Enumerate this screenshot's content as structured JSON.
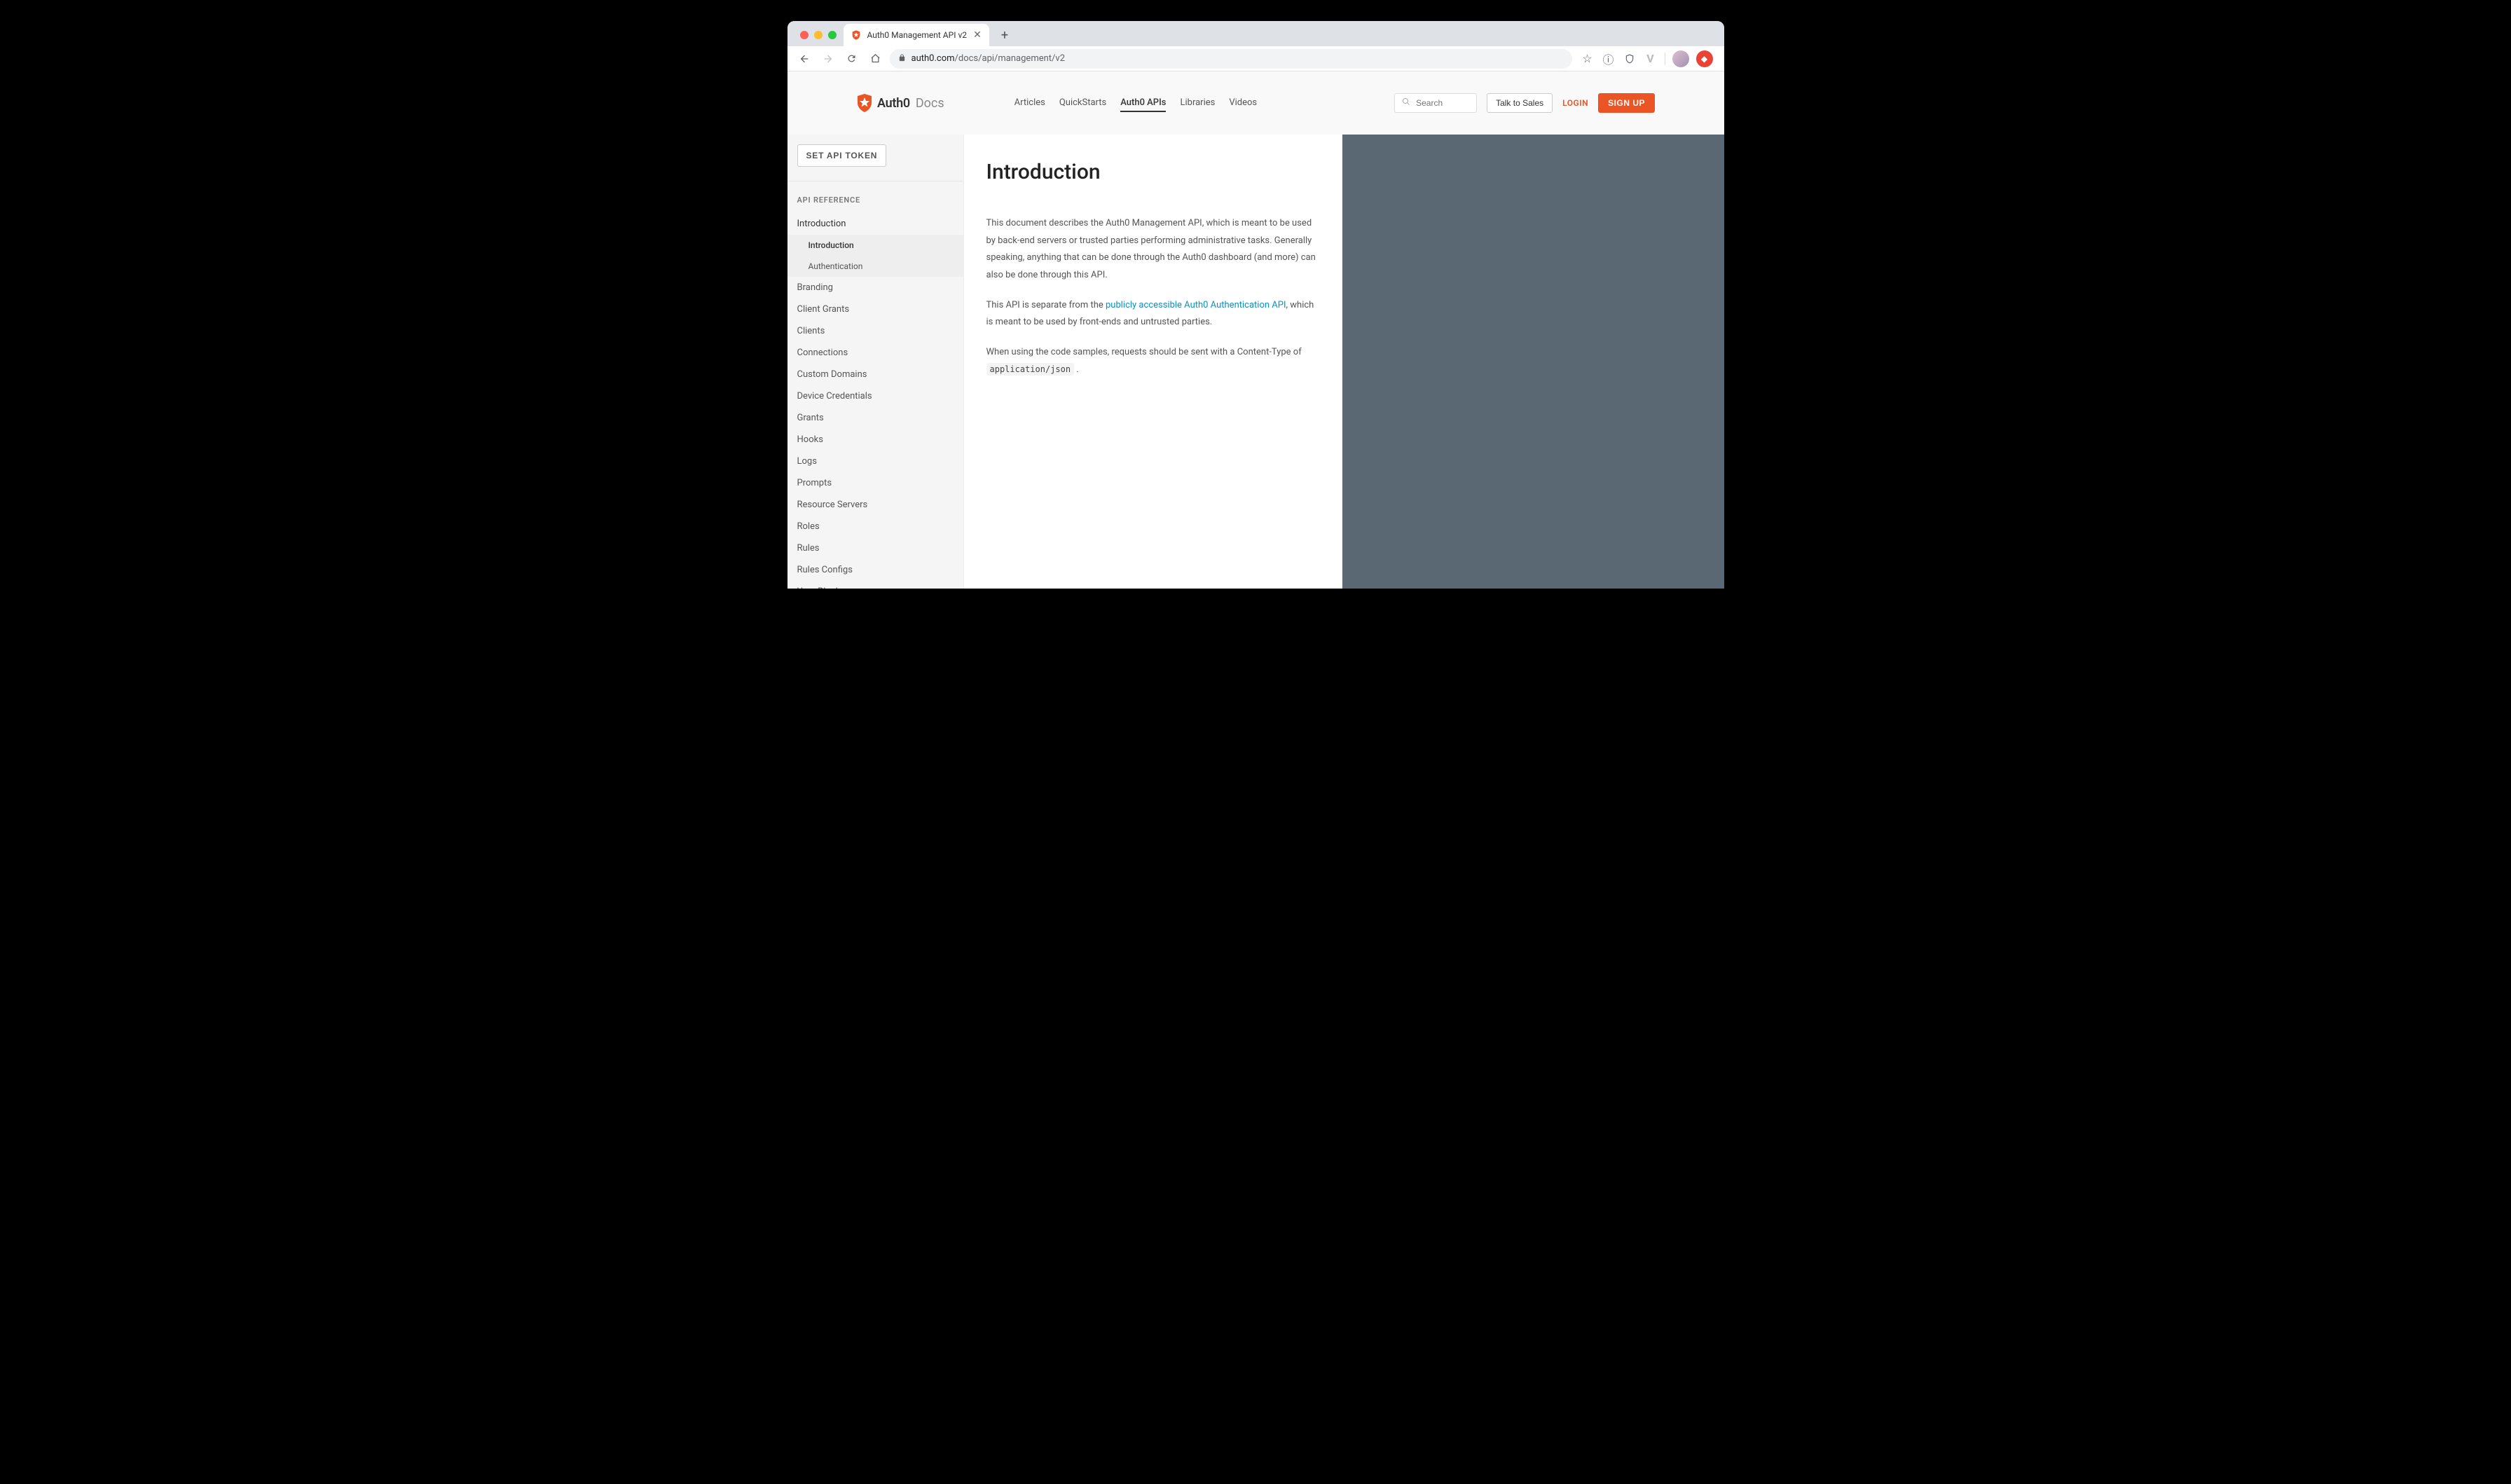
{
  "browser": {
    "tab_title": "Auth0 Management API v2",
    "url_host": "auth0.com",
    "url_path": "/docs/api/management/v2"
  },
  "header": {
    "brand": "Auth0",
    "docs_label": "Docs",
    "nav": [
      "Articles",
      "QuickStarts",
      "Auth0 APIs",
      "Libraries",
      "Videos"
    ],
    "active_nav": "Auth0 APIs",
    "search_placeholder": "Search",
    "talk_to_sales": "Talk to Sales",
    "login": "LOGIN",
    "signup": "SIGN UP"
  },
  "sidebar": {
    "set_token": "SET API TOKEN",
    "ref_heading": "API REFERENCE",
    "items": [
      "Introduction",
      "Branding",
      "Client Grants",
      "Clients",
      "Connections",
      "Custom Domains",
      "Device Credentials",
      "Grants",
      "Hooks",
      "Logs",
      "Prompts",
      "Resource Servers",
      "Roles",
      "Rules",
      "Rules Configs",
      "User Blocks"
    ],
    "intro_sub": [
      "Introduction",
      "Authentication"
    ],
    "active_sub": "Introduction"
  },
  "article": {
    "title": "Introduction",
    "p1": "This document describes the Auth0 Management API, which is meant to be used by back-end servers or trusted parties performing administrative tasks. Generally speaking, anything that can be done through the Auth0 dashboard (and more) can also be done through this API.",
    "p2a": "This API is separate from the ",
    "p2_link": "publicly accessible Auth0 Authentication API",
    "p2b": ", which is meant to be used by front-ends and untrusted parties.",
    "p3a": "When using the code samples, requests should be sent with a Content-Type of ",
    "p3_code": "application/json",
    "p3b": " ."
  }
}
